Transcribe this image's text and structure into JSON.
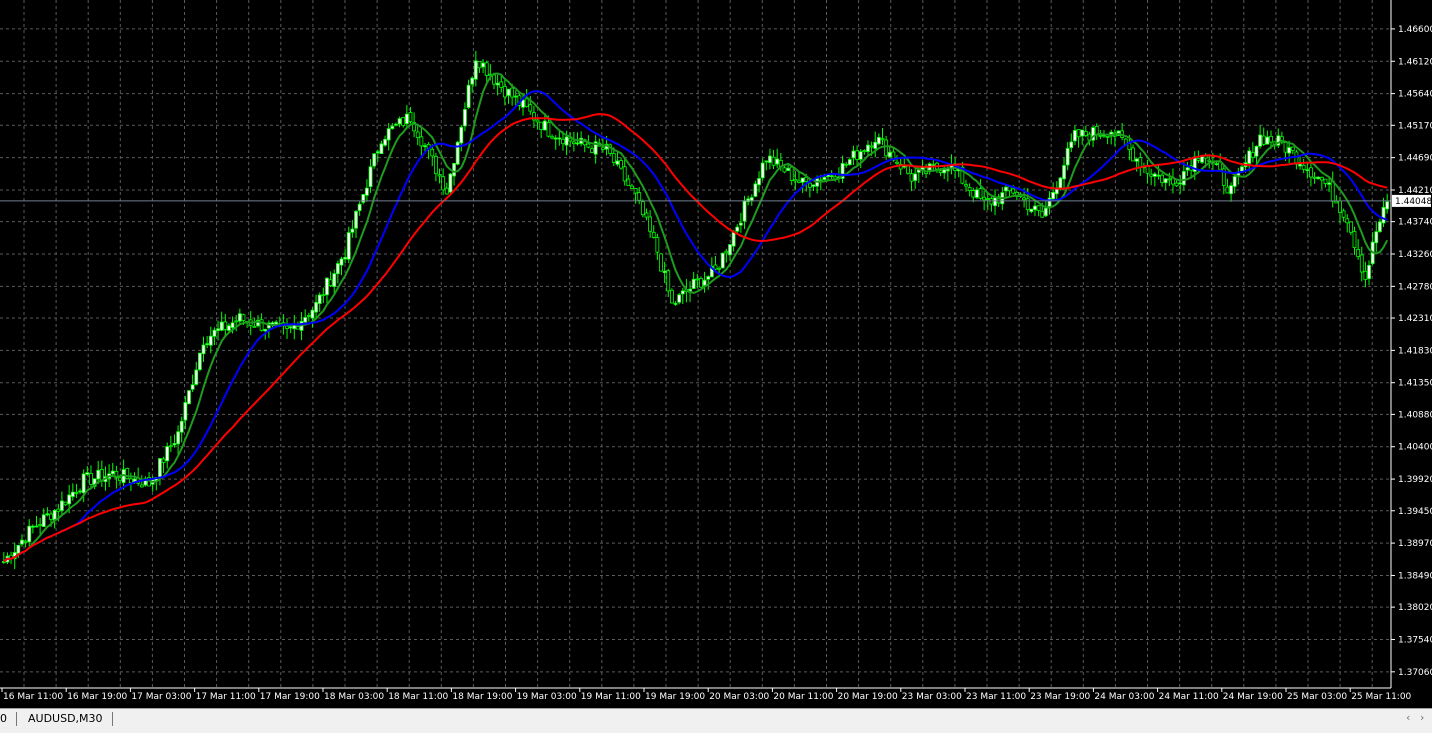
{
  "window": {
    "tab_label": "AUDUSD,M30",
    "tab_prefix": "0"
  },
  "colors": {
    "background": "#000000",
    "grid": "#5a5a5a",
    "bull": "#ffffff",
    "bear": "#000000",
    "wick": "#00ff00",
    "ma_fast": "#1e9c1e",
    "ma_mid": "#0000ff",
    "ma_slow": "#ff0000",
    "bid_line": "#708090",
    "axis_text": "#ffffff"
  },
  "chart_data": {
    "type": "candlestick",
    "symbol": "AUDUSD,M30",
    "current_price": "1.44048",
    "ylim": [
      1.3682,
      1.4694
    ],
    "y_ticks": [
      "1.46600",
      "1.46120",
      "1.45640",
      "1.45170",
      "1.44690",
      "1.44210",
      "1.43740",
      "1.43260",
      "1.42780",
      "1.42310",
      "1.41830",
      "1.41350",
      "1.40880",
      "1.40400",
      "1.39920",
      "1.39450",
      "1.38970",
      "1.38490",
      "1.38020",
      "1.37540",
      "1.37060"
    ],
    "x_ticks": [
      "16 Mar 11:00",
      "16 Mar 19:00",
      "17 Mar 03:00",
      "17 Mar 11:00",
      "17 Mar 19:00",
      "18 Mar 03:00",
      "18 Mar 11:00",
      "18 Mar 19:00",
      "19 Mar 03:00",
      "19 Mar 11:00",
      "19 Mar 19:00",
      "20 Mar 03:00",
      "20 Mar 11:00",
      "20 Mar 19:00",
      "23 Mar 03:00",
      "23 Mar 11:00",
      "23 Mar 19:00",
      "24 Mar 03:00",
      "24 Mar 11:00",
      "24 Mar 19:00",
      "25 Mar 03:00",
      "25 Mar 11:00"
    ],
    "candle_count": 272,
    "anchors": [
      [
        0,
        1.387
      ],
      [
        8,
        1.392
      ],
      [
        15,
        1.395
      ],
      [
        22,
        1.399
      ],
      [
        30,
        1.4
      ],
      [
        40,
        1.3985
      ],
      [
        48,
        1.406
      ],
      [
        55,
        1.42
      ],
      [
        65,
        1.423
      ],
      [
        78,
        1.421
      ],
      [
        86,
        1.425
      ],
      [
        94,
        1.433
      ],
      [
        104,
        1.45
      ],
      [
        112,
        1.453
      ],
      [
        122,
        1.442
      ],
      [
        130,
        1.462
      ],
      [
        136,
        1.458
      ],
      [
        142,
        1.455
      ],
      [
        150,
        1.451
      ],
      [
        158,
        1.449
      ],
      [
        166,
        1.448
      ],
      [
        174,
        1.441
      ],
      [
        180,
        1.433
      ],
      [
        184,
        1.425
      ],
      [
        190,
        1.428
      ],
      [
        196,
        1.43
      ],
      [
        202,
        1.437
      ],
      [
        210,
        1.447
      ],
      [
        220,
        1.443
      ],
      [
        230,
        1.445
      ],
      [
        240,
        1.45
      ],
      [
        250,
        1.444
      ],
      [
        260,
        1.446
      ],
      [
        270,
        1.44
      ],
      [
        278,
        1.442
      ],
      [
        286,
        1.438
      ],
      [
        295,
        1.45
      ],
      [
        305,
        1.451
      ],
      [
        315,
        1.445
      ],
      [
        322,
        1.443
      ],
      [
        330,
        1.448
      ],
      [
        338,
        1.442
      ],
      [
        346,
        1.45
      ],
      [
        352,
        1.449
      ],
      [
        358,
        1.446
      ],
      [
        364,
        1.443
      ],
      [
        370,
        1.438
      ],
      [
        375,
        1.429
      ],
      [
        378,
        1.436
      ],
      [
        381,
        1.44
      ]
    ],
    "candle_count_total": 382,
    "moving_averages": [
      {
        "period": "fast",
        "color": "#1e9c1e"
      },
      {
        "period": "mid",
        "color": "#0000ff"
      },
      {
        "period": "slow",
        "color": "#ff0000"
      }
    ],
    "grid": true
  }
}
